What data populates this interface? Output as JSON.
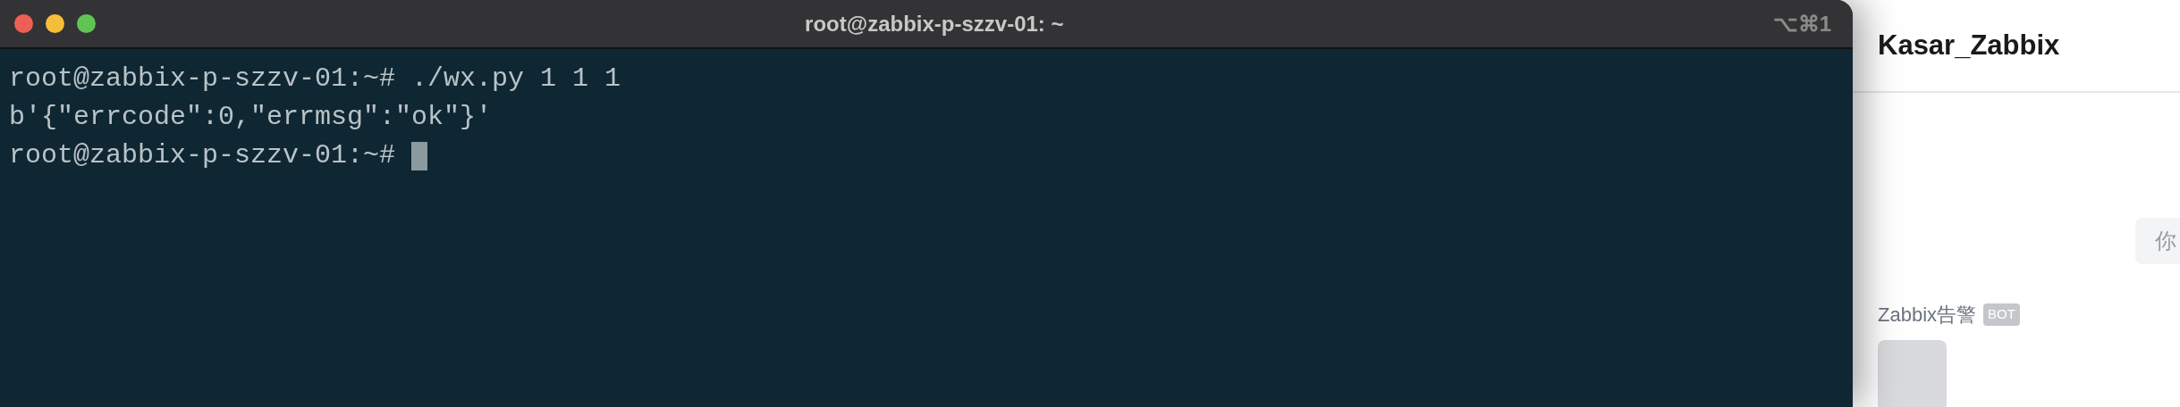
{
  "terminal": {
    "title": "root@zabbix-p-szzv-01: ~",
    "shortcut": "⌥⌘1",
    "lines": [
      {
        "text": "root@zabbix-p-szzv-01:~# ./wx.py 1 1 1",
        "cursor": false
      },
      {
        "text": "b'{\"errcode\":0,\"errmsg\":\"ok\"}'",
        "cursor": false
      },
      {
        "text": "root@zabbix-p-szzv-01:~#",
        "cursor": true
      }
    ]
  },
  "chat": {
    "title": "Kasar_Zabbix",
    "messages": [
      {
        "text": "你"
      }
    ],
    "sender": {
      "name": "Zabbix告警",
      "badge": "BOT"
    }
  }
}
